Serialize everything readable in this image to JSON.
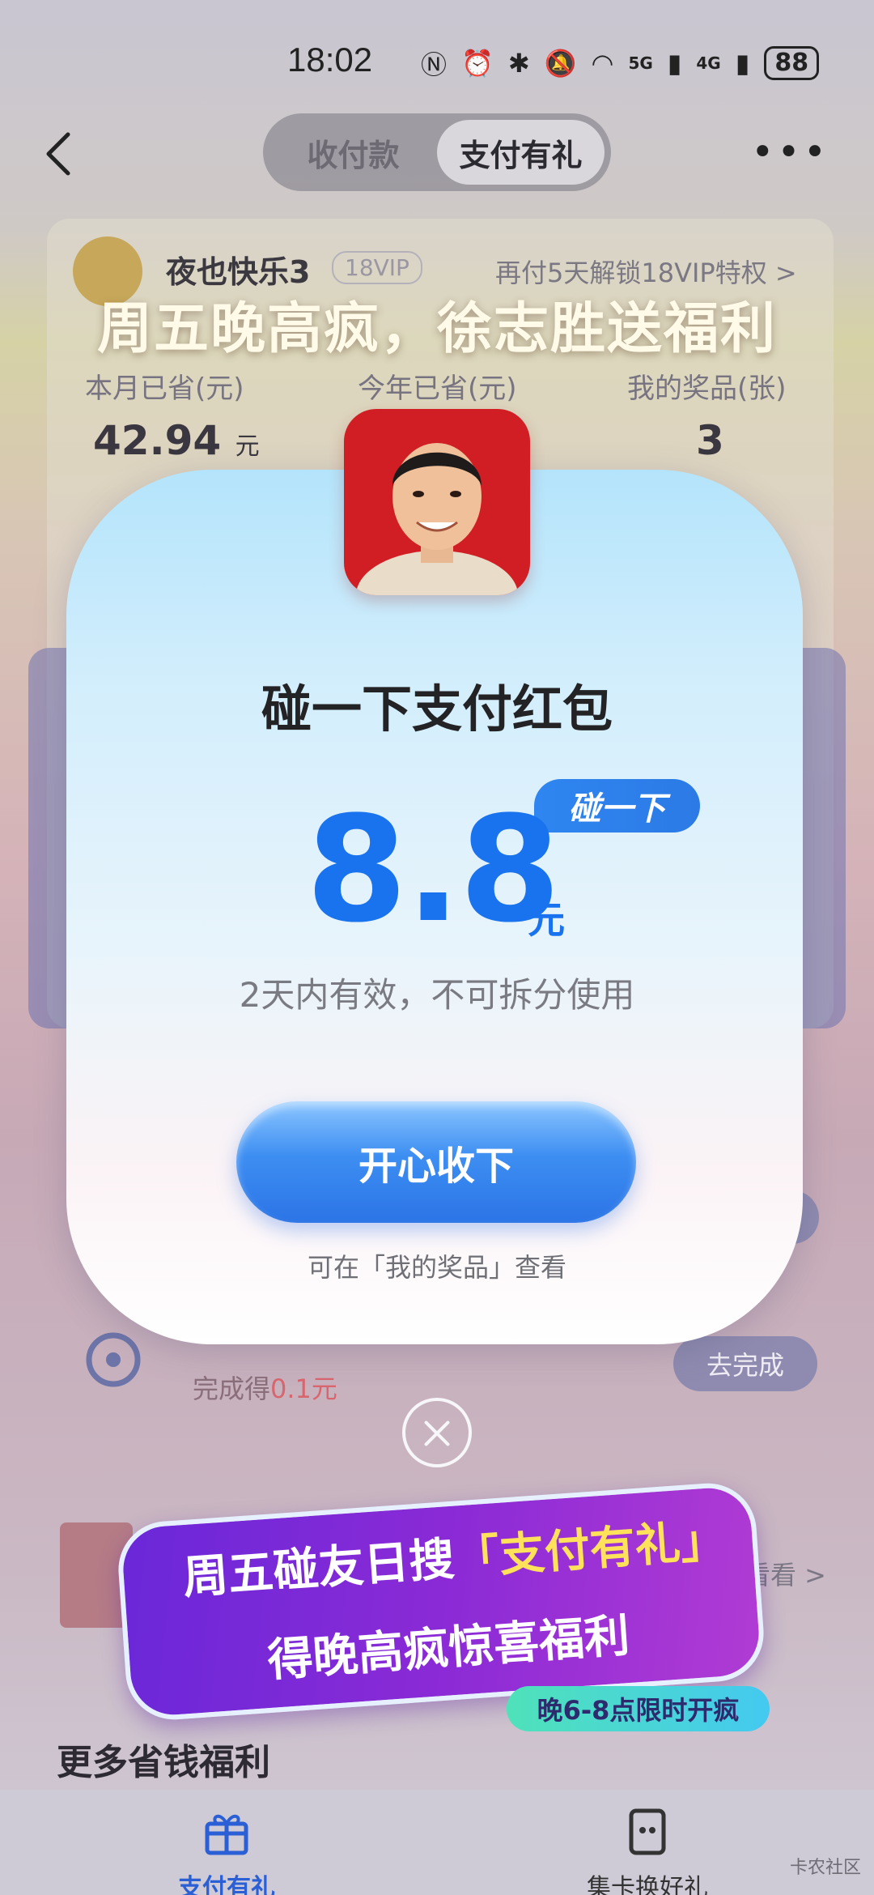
{
  "status_bar": {
    "time": "18:02",
    "net1": "5G",
    "net2": "4G",
    "battery": "88"
  },
  "nav": {
    "tabs": [
      {
        "label": "收付款"
      },
      {
        "label": "支付有礼"
      }
    ],
    "active_tab": 1,
    "more_label": "•••"
  },
  "profile": {
    "nickname": "夜也快乐3",
    "vip": "18VIP",
    "unlock_text": "再付5天解锁18VIP特权 >"
  },
  "stats": [
    {
      "label": "本月已省(元)",
      "value": "42.94",
      "unit": "元"
    },
    {
      "label": "今年已省(元)",
      "value": ""
    },
    {
      "label": "我的奖品(张)",
      "value": "3"
    }
  ],
  "headline": "周五晚高疯，徐志胜送福利",
  "popup": {
    "title": "碰一下支付红包",
    "tag": "碰一下",
    "amount": "8.8",
    "unit": "元",
    "validity": "2天内有效，不可拆分使用",
    "accept_label": "开心收下",
    "hint": "可在「我的奖品」查看"
  },
  "task": {
    "reward_prefix": "完成得",
    "reward_value": "0.1元",
    "button": "去完成"
  },
  "look_more": "看看 >",
  "banner": {
    "line1_prefix": "周五碰友日搜",
    "line1_highlight": "「支付有礼」",
    "line2": "得晚高疯惊喜福利",
    "tag": "晚6-8点限时开疯"
  },
  "more_title": "更多省钱福利",
  "bottom_tabs": [
    {
      "label": "支付有礼"
    },
    {
      "label": "集卡换好礼"
    }
  ],
  "watermark": "卡农社区",
  "colors": {
    "accent": "#1a73ee",
    "banner": "#8a2ad6",
    "photo_bg": "#d01e24"
  }
}
